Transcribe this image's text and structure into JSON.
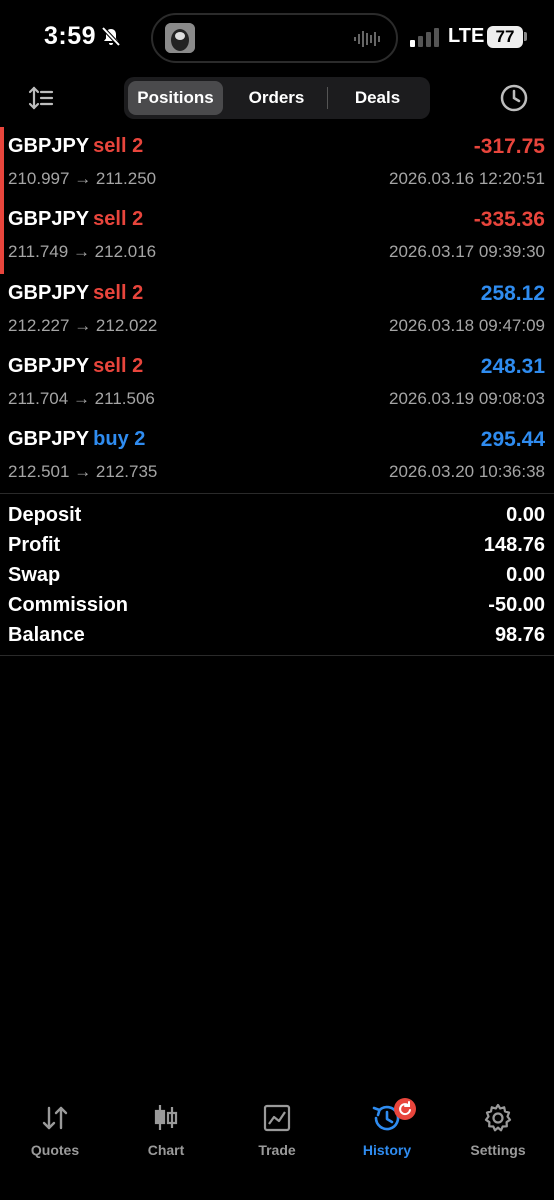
{
  "status": {
    "time": "3:59",
    "network": "LTE",
    "battery": "77"
  },
  "tabs": {
    "positions": "Positions",
    "orders": "Orders",
    "deals": "Deals"
  },
  "trades": [
    {
      "symbol": "GBPJPY",
      "side": "sell 2",
      "open": "210.997",
      "close": "211.250",
      "profit": "-317.75",
      "time": "2026.03.16 12:20:51"
    },
    {
      "symbol": "GBPJPY",
      "side": "sell 2",
      "open": "211.749",
      "close": "212.016",
      "profit": "-335.36",
      "time": "2026.03.17 09:39:30"
    },
    {
      "symbol": "GBPJPY",
      "side": "sell 2",
      "open": "212.227",
      "close": "212.022",
      "profit": "258.12",
      "time": "2026.03.18 09:47:09"
    },
    {
      "symbol": "GBPJPY",
      "side": "sell 2",
      "open": "211.704",
      "close": "211.506",
      "profit": "248.31",
      "time": "2026.03.19 09:08:03"
    },
    {
      "symbol": "GBPJPY",
      "side": "buy 2",
      "open": "212.501",
      "close": "212.735",
      "profit": "295.44",
      "time": "2026.03.20 10:36:38"
    }
  ],
  "arrow": "→",
  "summary": {
    "deposit": {
      "label": "Deposit",
      "value": "0.00"
    },
    "profit": {
      "label": "Profit",
      "value": "148.76"
    },
    "swap": {
      "label": "Swap",
      "value": "0.00"
    },
    "commission": {
      "label": "Commission",
      "value": "-50.00"
    },
    "balance": {
      "label": "Balance",
      "value": "98.76"
    }
  },
  "nav": {
    "quotes": "Quotes",
    "chart": "Chart",
    "trade": "Trade",
    "history": "History",
    "settings": "Settings"
  },
  "colors": {
    "loss": "#e8453c",
    "gain": "#2f8cf0",
    "accent": "#2f8cf0"
  }
}
